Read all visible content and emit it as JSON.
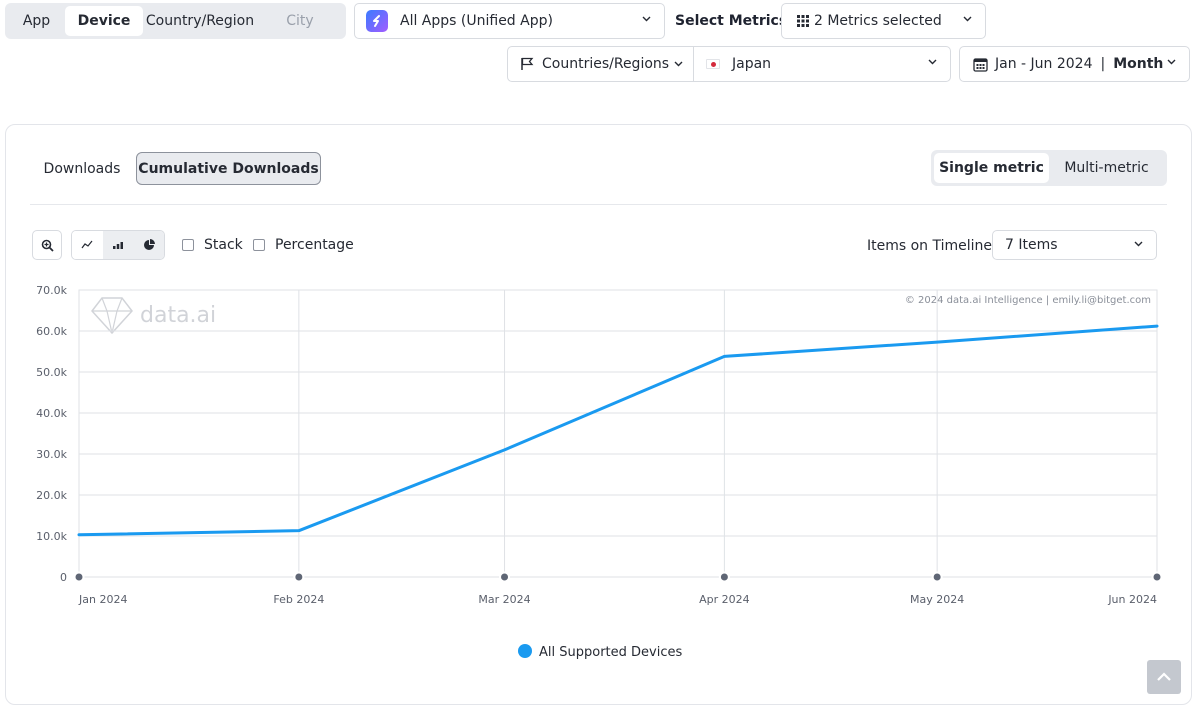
{
  "top_tabs": [
    {
      "label": "App",
      "state": "normal"
    },
    {
      "label": "Device",
      "state": "active"
    },
    {
      "label": "Country/Region",
      "state": "normal"
    },
    {
      "label": "City",
      "state": "disabled"
    }
  ],
  "app_select": {
    "value": "All Apps (Unified App)",
    "icon": "unified-app-logo"
  },
  "metrics": {
    "label": "Select Metrics:",
    "value": "2 Metrics selected",
    "icon": "grid-icon"
  },
  "region_filter": {
    "type_label": "Countries/Regions",
    "type_icon": "flag-icon",
    "country": "Japan",
    "country_icon": "japan-flag-icon"
  },
  "date_range": {
    "range": "Jan - Jun 2024",
    "separator": "|",
    "granularity": "Month",
    "icon": "calendar-icon"
  },
  "card": {
    "view_tabs": [
      {
        "label": "Downloads",
        "selected": false
      },
      {
        "label": "Cumulative Downloads",
        "selected": true
      }
    ],
    "metric_mode": [
      {
        "label": "Single metric",
        "selected": true
      },
      {
        "label": "Multi-metric",
        "selected": false
      }
    ],
    "toolbar": {
      "zoom_icon": "zoom-in-icon",
      "chart_types": [
        "line-chart-icon",
        "bar-chart-icon",
        "pie-chart-icon"
      ],
      "stack_label": "Stack",
      "percentage_label": "Percentage",
      "items_label": "Items on Timeline:",
      "items_value": "7 Items"
    },
    "watermark": "data.ai",
    "copyright": "© 2024 data.ai Intelligence | emily.li@bitget.com"
  },
  "chart_data": {
    "type": "line",
    "title": "",
    "xlabel": "",
    "ylabel": "",
    "x": [
      "Jan 2024",
      "Feb 2024",
      "Mar 2024",
      "Apr 2024",
      "May 2024",
      "Jun 2024"
    ],
    "series": [
      {
        "name": "All Supported Devices",
        "color": "#1a9af0",
        "values": [
          10300,
          11300,
          31000,
          53800,
          57300,
          61200
        ]
      }
    ],
    "ylim": [
      0,
      70000
    ],
    "yticks": [
      0,
      10000,
      20000,
      30000,
      40000,
      50000,
      60000,
      70000
    ],
    "ytick_labels": [
      "0",
      "10.0k",
      "20.0k",
      "30.0k",
      "40.0k",
      "50.0k",
      "60.0k",
      "70.0k"
    ],
    "grid": true,
    "legend_position": "bottom-center"
  }
}
